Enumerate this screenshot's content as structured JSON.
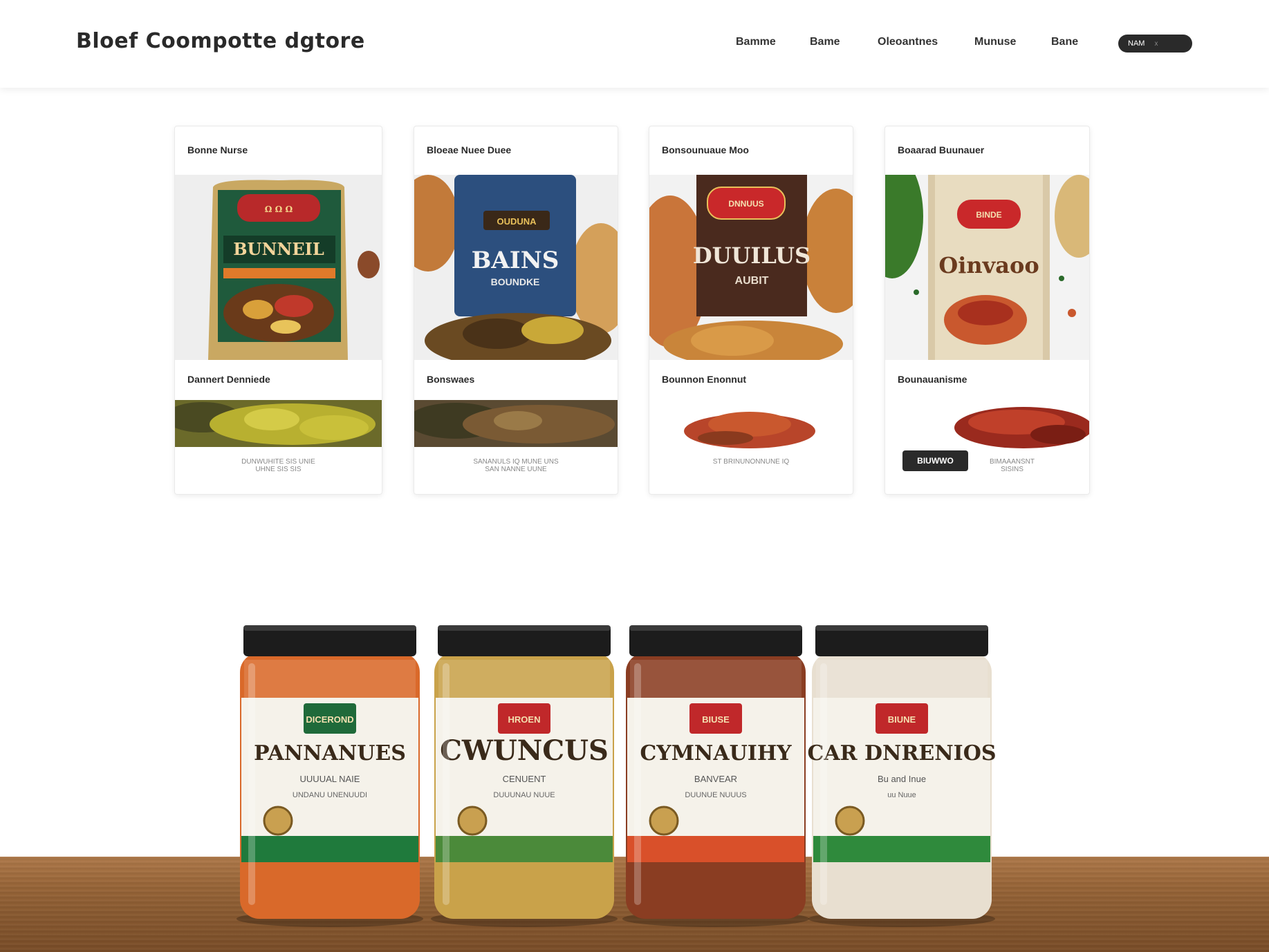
{
  "header": {
    "brand": "Bloef Coompotte dgtore",
    "nav": [
      "Bamme",
      "Bame",
      "Oleoantnes",
      "Munuse",
      "Bane"
    ],
    "button_label": "NAM",
    "button_close": "x"
  },
  "cards": [
    {
      "title": "Bonne Nurse",
      "subtitle": "Dannert Denniede",
      "meta_line1": "DUNWUHITE SIS UNIE",
      "meta_line2": "UHNE SIS SIS",
      "button": ""
    },
    {
      "title": "Bloeae Nuee Duee",
      "subtitle": "Bonswaes",
      "meta_line1": "SANANULS IQ MUNE UNS",
      "meta_line2": "SAN NANNE UUNE",
      "button": ""
    },
    {
      "title": "Bonsounuaue Moo",
      "subtitle": "Bounnon Enonnut",
      "meta_line1": "ST BRINUNONNUNE IQ",
      "meta_line2": "",
      "button": ""
    },
    {
      "title": "Boaarad Buunauer",
      "subtitle": "Bounauanisme",
      "meta_line1": "BIMAAANSNT",
      "meta_line2": "SISINS",
      "button": "BIUWWO"
    }
  ],
  "card_packages": [
    {
      "badge": "",
      "name": "BUNNEIL",
      "sub": ""
    },
    {
      "badge": "OUDUNA",
      "name": "BAINS",
      "sub": "BOUNDKE"
    },
    {
      "badge": "DNNUUS",
      "name": "DUUILUS",
      "sub": "AUBIT"
    },
    {
      "badge": "BINDE",
      "name": "Oinvaoo",
      "sub": ""
    }
  ],
  "jars": [
    {
      "badge": "DICEROND",
      "name": "PANNANUES",
      "line1": "UUUUAL NAIE",
      "line2": "UNDANU UNENUUDI",
      "fill": "#d9692a",
      "band": "#1f7a3c",
      "badge_color": "#1f6a3a"
    },
    {
      "badge": "HROEN",
      "name": "CWUNCUS",
      "line1": "CENUENT",
      "line2": "DUUUNAU NUUE",
      "fill": "#c9a24a",
      "band": "#4b8a3a",
      "badge_color": "#c0282a"
    },
    {
      "badge": "BIUSE",
      "name": "CYMNAUIHY",
      "line1": "BANVEAR",
      "line2": "DUUNUE NUUUS",
      "fill": "#8a3d22",
      "band": "#d9502a",
      "badge_color": "#c0282a"
    },
    {
      "badge": "BIUNE",
      "name": "CAR DNRENIOS",
      "line1": "Bu and Inue",
      "line2": "uu Nuue",
      "fill": "#e8dfd0",
      "band": "#2f8a3c",
      "badge_color": "#c0282a"
    }
  ],
  "colors": {
    "dark": "#2a2a2a",
    "wood": "#9a6638",
    "lid": "#1c1c1c"
  }
}
